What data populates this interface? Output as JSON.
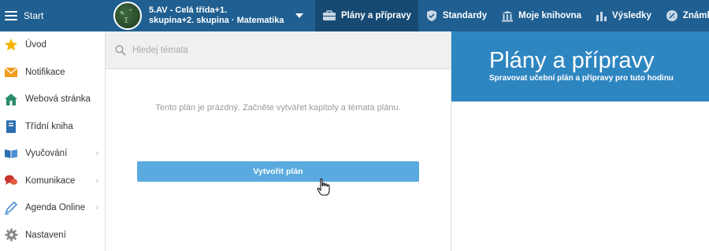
{
  "topbar": {
    "start_label": "Start",
    "class_line1": "5.AV - Celá třída+1.",
    "class_line2": "skupina+2. skupina · Matematika",
    "nav": [
      {
        "label": "Plány a přípravy",
        "icon": "briefcase-icon",
        "active": true
      },
      {
        "label": "Standardy",
        "icon": "shield-icon",
        "active": false
      },
      {
        "label": "Moje knihovna",
        "icon": "library-icon",
        "active": false
      },
      {
        "label": "Výsledky",
        "icon": "bar-chart-icon",
        "active": false
      },
      {
        "label": "Známk",
        "icon": "grades-icon",
        "active": false
      }
    ]
  },
  "sidebar": {
    "items": [
      {
        "label": "Úvod",
        "icon": "star-icon",
        "has_chevron": false
      },
      {
        "label": "Notifikace",
        "icon": "envelope-icon",
        "has_chevron": false
      },
      {
        "label": "Webová stránka",
        "icon": "home-icon",
        "has_chevron": false
      },
      {
        "label": "Třídní kniha",
        "icon": "book-icon",
        "has_chevron": false
      },
      {
        "label": "Vyučování",
        "icon": "open-book-icon",
        "has_chevron": true
      },
      {
        "label": "Komunikace",
        "icon": "chat-icon",
        "has_chevron": true
      },
      {
        "label": "Agenda Online",
        "icon": "pen-icon",
        "has_chevron": true
      },
      {
        "label": "Nastavení",
        "icon": "gear-icon",
        "has_chevron": false
      }
    ]
  },
  "main": {
    "search_placeholder": "Hledej témata",
    "empty_message": "Tento plán je prázdný. Začněte vytvářet kapitoly a témata plánu.",
    "create_button": "Vytvořit plán"
  },
  "right": {
    "title": "Plány a přípravy",
    "subtitle": "Spravovat učební plán a přípravy pro tuto hodinu"
  },
  "colors": {
    "topbar": "#1f5f91",
    "topbar_active": "#174a73",
    "hero": "#2e86c1",
    "button": "#5aaadf"
  }
}
